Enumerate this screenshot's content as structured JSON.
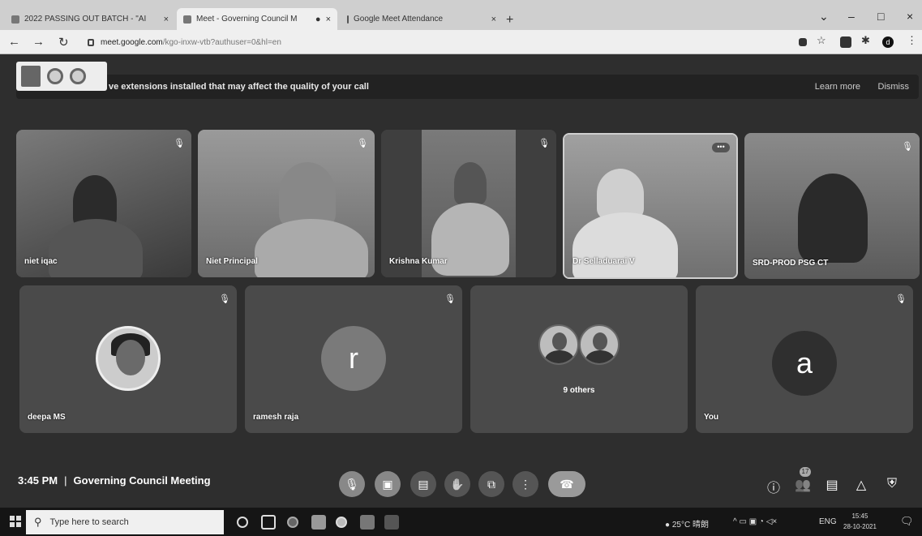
{
  "browser": {
    "tabs": [
      {
        "title": "2022 PASSING OUT BATCH - \"AI",
        "active": false
      },
      {
        "title": "Meet - Governing Council M",
        "active": true
      },
      {
        "title": "Google Meet Attendance",
        "active": false
      }
    ],
    "url": "meet.google.com",
    "url_rest": "/kgo-inxw-vtb?authuser=0&hl=en",
    "new_tab_glyph": "+",
    "window_controls": {
      "minimize": "–",
      "maximize": "□",
      "close": "×",
      "tab_search": "⌄"
    },
    "profile_initial": "d"
  },
  "banner": {
    "message": "ve extensions installed that may affect the quality of your call",
    "learn_more": "Learn more",
    "dismiss": "Dismiss"
  },
  "participants_top": [
    {
      "name": "niet iqac",
      "muted": true
    },
    {
      "name": "Niet Principal",
      "muted": true
    },
    {
      "name": "Krishna Kumar",
      "muted": true
    },
    {
      "name": "Dr Selladuarai V",
      "muted": false,
      "menu": true
    },
    {
      "name": "SRD-PROD PSG CT",
      "muted": true
    }
  ],
  "participants_bottom": [
    {
      "name": "deepa MS",
      "muted": true,
      "avatar_type": "photo"
    },
    {
      "name": "ramesh raja",
      "muted": true,
      "avatar_initial": "r"
    },
    {
      "name": "",
      "others_label": "9 others",
      "avatar_type": "group"
    },
    {
      "name": "You",
      "muted": true,
      "avatar_initial": "a"
    }
  ],
  "meeting": {
    "time": "3:45 PM",
    "separator": "|",
    "title": "Governing Council Meeting",
    "participant_count": "17"
  },
  "taskbar": {
    "search_placeholder": "Type here to search",
    "weather": "25°C 晴朗",
    "language": "ENG",
    "time": "15:45",
    "date": "28-10-2021"
  },
  "colors": {
    "banner_bg": "#222222",
    "tile_bg": "#4a4a4a",
    "meet_bg": "#2e2e2e"
  }
}
